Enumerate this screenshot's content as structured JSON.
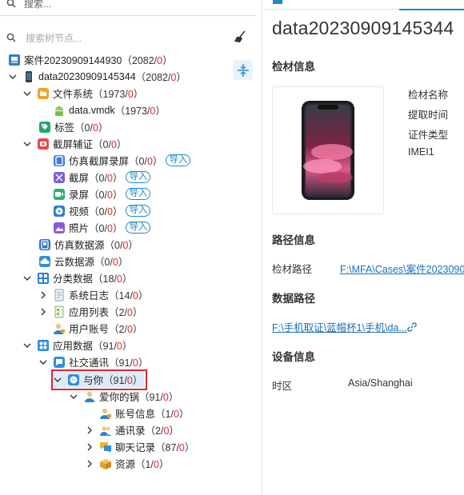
{
  "top_search": {
    "placeholder": "搜索..."
  },
  "tree_search": {
    "placeholder": "搜索树节点..."
  },
  "tree": [
    {
      "label": "案件20230909144930",
      "count": "2082",
      "red": "0"
    },
    {
      "label": "data20230909145344",
      "count": "2082",
      "red": "0"
    },
    {
      "label": "文件系统",
      "count": "1973",
      "red": "0"
    },
    {
      "label": "data.vmdk",
      "count": "1973",
      "red": "0"
    },
    {
      "label": "标签",
      "count": "0",
      "red": "0"
    },
    {
      "label": "截屏辅证",
      "count": "0",
      "red": "0"
    },
    {
      "label": "仿真截屏录屏",
      "count": "0",
      "red": "0",
      "import": "导入"
    },
    {
      "label": "截屏",
      "count": "0",
      "red": "0",
      "import": "导入"
    },
    {
      "label": "录屏",
      "count": "0",
      "red": "0",
      "import": "导入"
    },
    {
      "label": "视频",
      "count": "0",
      "red": "0",
      "import": "导入"
    },
    {
      "label": "照片",
      "count": "0",
      "red": "0",
      "import": "导入"
    },
    {
      "label": "仿真数据源",
      "count": "0",
      "red": "0"
    },
    {
      "label": "云数据源",
      "count": "0",
      "red": "0"
    },
    {
      "label": "分类数据",
      "count": "18",
      "red": "0"
    },
    {
      "label": "系统日志",
      "count": "14",
      "red": "0"
    },
    {
      "label": "应用列表",
      "count": "2",
      "red": "0"
    },
    {
      "label": "用户账号",
      "count": "2",
      "red": "0"
    },
    {
      "label": "应用数据",
      "count": "91",
      "red": "0"
    },
    {
      "label": "社交通讯",
      "count": "91",
      "red": "0"
    },
    {
      "label": "与你",
      "count": "91",
      "red": "0"
    },
    {
      "label": "爱你的锅",
      "count": "91",
      "red": "0"
    },
    {
      "label": "账号信息",
      "count": "1",
      "red": "0"
    },
    {
      "label": "通讯录",
      "count": "2",
      "red": "0"
    },
    {
      "label": "聊天记录",
      "count": "87",
      "red": "0"
    },
    {
      "label": "资源",
      "count": "1",
      "red": "0"
    }
  ],
  "detail": {
    "title": "data20230909145344",
    "section_material": "检材信息",
    "fields": [
      "检材名称",
      "提取时间",
      "证件类型",
      "IMEI1"
    ],
    "section_path": "路径信息",
    "path_label": "检材路径",
    "path_value": "F:\\MFA\\Cases\\案件2023090",
    "section_data_path": "数据路径",
    "data_path_value": "F:\\手机取证\\蓝帽杯1\\手机\\da... ",
    "section_device": "设备信息",
    "timezone_label": "时区",
    "timezone_value": "Asia/Shanghai"
  },
  "colors": {
    "accent": "#1e88c8",
    "red": "#e0282e",
    "selected_bg": "#dcebf8"
  }
}
